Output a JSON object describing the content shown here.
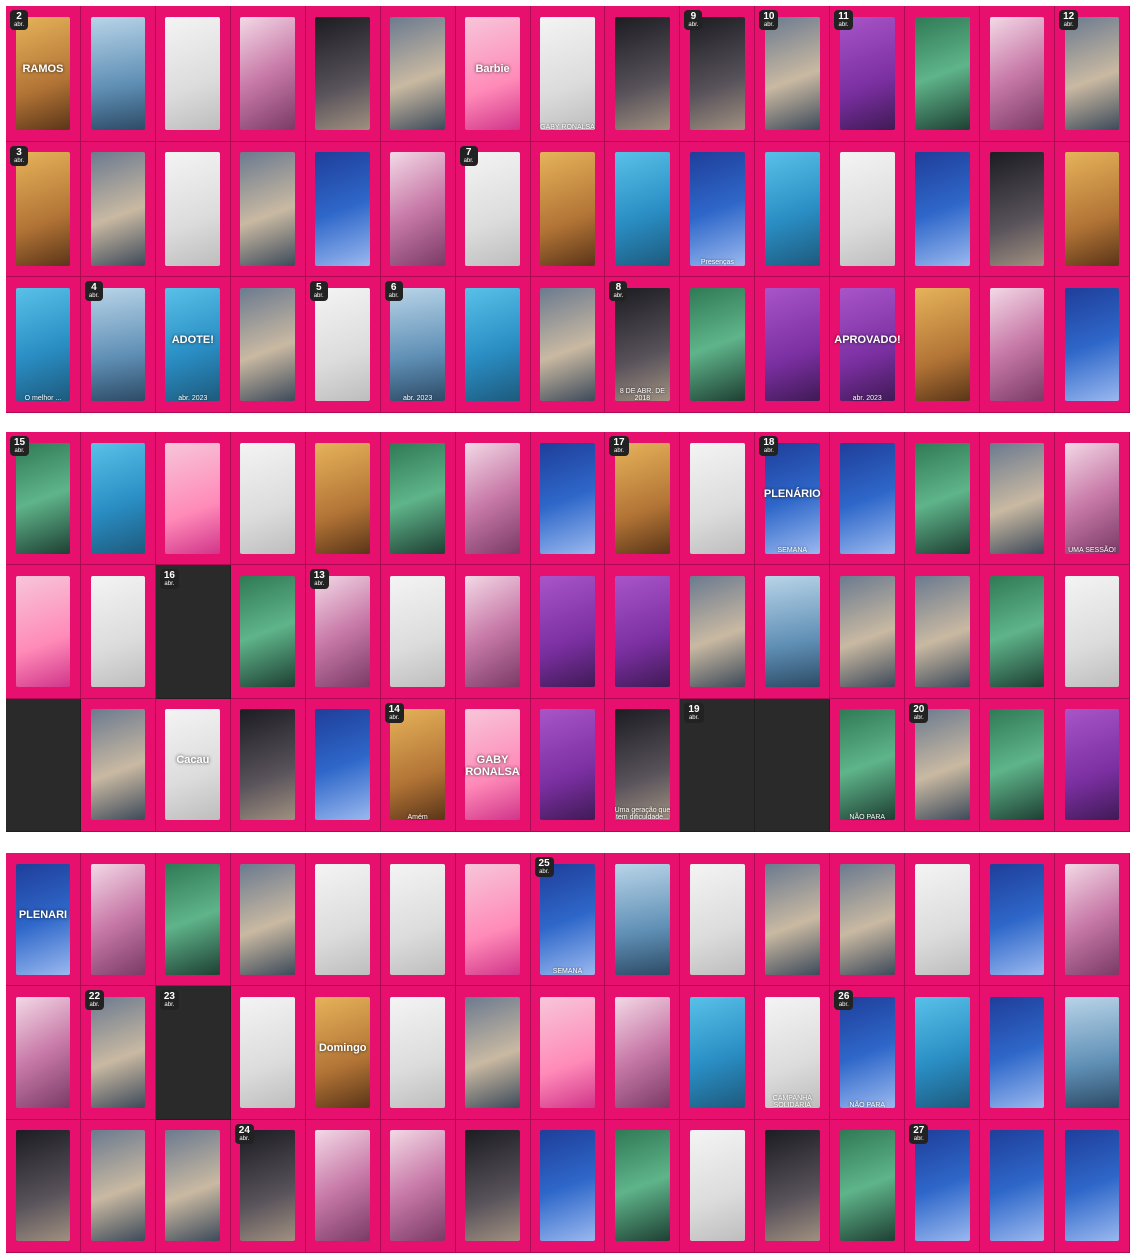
{
  "panels": [
    {
      "name": "april-week-1",
      "rows": [
        [
          {
            "style": "ph-i",
            "badge": "2",
            "sub": "abr.",
            "big": "RAMOS"
          },
          {
            "style": "ph-b"
          },
          {
            "style": "ph-f"
          },
          {
            "style": "ph-c"
          },
          {
            "style": "ph-d"
          },
          {
            "style": "ph-a"
          },
          {
            "style": "ph-k",
            "big": "Barbie"
          },
          {
            "style": "ph-f",
            "cap": "GABY RONALSA"
          },
          {
            "style": "ph-d"
          },
          {
            "style": "ph-d",
            "badge": "9",
            "sub": "abr."
          },
          {
            "style": "ph-a",
            "badge": "10",
            "sub": "abr."
          },
          {
            "style": "ph-g",
            "badge": "11",
            "sub": "abr."
          },
          {
            "style": "ph-e"
          },
          {
            "style": "ph-c"
          },
          {
            "style": "ph-a",
            "badge": "12",
            "sub": "abr."
          }
        ],
        [
          {
            "style": "ph-i",
            "badge": "3",
            "sub": "abr."
          },
          {
            "style": "ph-a"
          },
          {
            "style": "ph-f"
          },
          {
            "style": "ph-a"
          },
          {
            "style": "ph-h"
          },
          {
            "style": "ph-c"
          },
          {
            "style": "ph-f",
            "badge": "7",
            "sub": "abr."
          },
          {
            "style": "ph-i"
          },
          {
            "style": "ph-j"
          },
          {
            "style": "ph-h",
            "cap": "Presenças"
          },
          {
            "style": "ph-j"
          },
          {
            "style": "ph-f"
          },
          {
            "style": "ph-h"
          },
          {
            "style": "ph-d"
          },
          {
            "style": "ph-i"
          }
        ],
        [
          {
            "style": "ph-j",
            "cap": "O melhor ..."
          },
          {
            "style": "ph-b",
            "badge": "4",
            "sub": "abr."
          },
          {
            "style": "ph-j",
            "big": "ADOTE!",
            "cap": "abr. 2023"
          },
          {
            "style": "ph-a"
          },
          {
            "style": "ph-f",
            "badge": "5",
            "sub": "abr."
          },
          {
            "style": "ph-b",
            "badge": "6",
            "sub": "abr.",
            "cap": "abr. 2023"
          },
          {
            "style": "ph-j"
          },
          {
            "style": "ph-a"
          },
          {
            "style": "ph-d",
            "badge": "8",
            "sub": "abr.",
            "cap": "8 DE ABR. DE 2018"
          },
          {
            "style": "ph-e"
          },
          {
            "style": "ph-g"
          },
          {
            "style": "ph-g",
            "big": "APROVADO!",
            "cap": "abr. 2023"
          },
          {
            "style": "ph-i"
          },
          {
            "style": "ph-c"
          },
          {
            "style": "ph-h"
          }
        ]
      ]
    },
    {
      "name": "april-week-2",
      "rows": [
        [
          {
            "style": "ph-e",
            "badge": "15",
            "sub": "abr."
          },
          {
            "style": "ph-j"
          },
          {
            "style": "ph-k"
          },
          {
            "style": "ph-f"
          },
          {
            "style": "ph-i"
          },
          {
            "style": "ph-e"
          },
          {
            "style": "ph-c"
          },
          {
            "style": "ph-h"
          },
          {
            "style": "ph-i",
            "badge": "17",
            "sub": "abr."
          },
          {
            "style": "ph-f"
          },
          {
            "style": "ph-h",
            "badge": "18",
            "sub": "abr.",
            "big": "PLENÁRIO",
            "cap": "SEMANA"
          },
          {
            "style": "ph-h"
          },
          {
            "style": "ph-e"
          },
          {
            "style": "ph-a"
          },
          {
            "style": "ph-c",
            "cap": "UMA SESSÃO!"
          }
        ],
        [
          {
            "style": "ph-k"
          },
          {
            "style": "ph-f"
          },
          {
            "style": "dark",
            "badge": "16",
            "sub": "abr."
          },
          {
            "style": "ph-e"
          },
          {
            "style": "ph-c",
            "badge": "13",
            "sub": "abr."
          },
          {
            "style": "ph-f"
          },
          {
            "style": "ph-c"
          },
          {
            "style": "ph-g"
          },
          {
            "style": "ph-g"
          },
          {
            "style": "ph-a"
          },
          {
            "style": "ph-b"
          },
          {
            "style": "ph-a"
          },
          {
            "style": "ph-a"
          },
          {
            "style": "ph-e"
          },
          {
            "style": "ph-f"
          }
        ],
        [
          {
            "style": "dark"
          },
          {
            "style": "ph-a"
          },
          {
            "style": "ph-f",
            "big": "Cacau"
          },
          {
            "style": "ph-d"
          },
          {
            "style": "ph-h"
          },
          {
            "style": "ph-i",
            "badge": "14",
            "sub": "abr.",
            "cap": "Amém"
          },
          {
            "style": "ph-k",
            "big": "GABY RONALSA"
          },
          {
            "style": "ph-g"
          },
          {
            "style": "ph-d",
            "cap": "Uma geração que tem dificuldade..."
          },
          {
            "style": "dark",
            "badge": "19",
            "sub": "abr."
          },
          {
            "style": "dark"
          },
          {
            "style": "ph-e",
            "cap": "NÃO PARA"
          },
          {
            "style": "ph-a",
            "badge": "20",
            "sub": "abr."
          },
          {
            "style": "ph-e"
          },
          {
            "style": "ph-g"
          }
        ]
      ]
    },
    {
      "name": "april-week-3",
      "rows": [
        [
          {
            "style": "ph-h",
            "big": "PLENARI"
          },
          {
            "style": "ph-c"
          },
          {
            "style": "ph-e"
          },
          {
            "style": "ph-a"
          },
          {
            "style": "ph-f"
          },
          {
            "style": "ph-f"
          },
          {
            "style": "ph-k"
          },
          {
            "style": "ph-h",
            "badge": "25",
            "sub": "abr.",
            "cap": "SEMANA"
          },
          {
            "style": "ph-b"
          },
          {
            "style": "ph-f"
          },
          {
            "style": "ph-a"
          },
          {
            "style": "ph-a"
          },
          {
            "style": "ph-f"
          },
          {
            "style": "ph-h"
          },
          {
            "style": "ph-c"
          }
        ],
        [
          {
            "style": "ph-c"
          },
          {
            "style": "ph-a",
            "badge": "22",
            "sub": "abr."
          },
          {
            "style": "dark",
            "badge": "23",
            "sub": "abr."
          },
          {
            "style": "ph-f"
          },
          {
            "style": "ph-i",
            "big": "Domingo"
          },
          {
            "style": "ph-f"
          },
          {
            "style": "ph-a"
          },
          {
            "style": "ph-k"
          },
          {
            "style": "ph-c"
          },
          {
            "style": "ph-j"
          },
          {
            "style": "ph-f",
            "cap": "CAMPANHA SOLIDÁRIA"
          },
          {
            "style": "ph-h",
            "badge": "26",
            "sub": "abr.",
            "cap": "NÃO PARA"
          },
          {
            "style": "ph-j"
          },
          {
            "style": "ph-h"
          },
          {
            "style": "ph-b"
          }
        ],
        [
          {
            "style": "ph-d"
          },
          {
            "style": "ph-a"
          },
          {
            "style": "ph-a"
          },
          {
            "style": "ph-d",
            "badge": "24",
            "sub": "abr."
          },
          {
            "style": "ph-c"
          },
          {
            "style": "ph-c"
          },
          {
            "style": "ph-d"
          },
          {
            "style": "ph-h"
          },
          {
            "style": "ph-e"
          },
          {
            "style": "ph-f"
          },
          {
            "style": "ph-d"
          },
          {
            "style": "ph-e"
          },
          {
            "style": "ph-h",
            "badge": "27",
            "sub": "abr."
          },
          {
            "style": "ph-h"
          },
          {
            "style": "ph-h"
          }
        ]
      ]
    }
  ]
}
